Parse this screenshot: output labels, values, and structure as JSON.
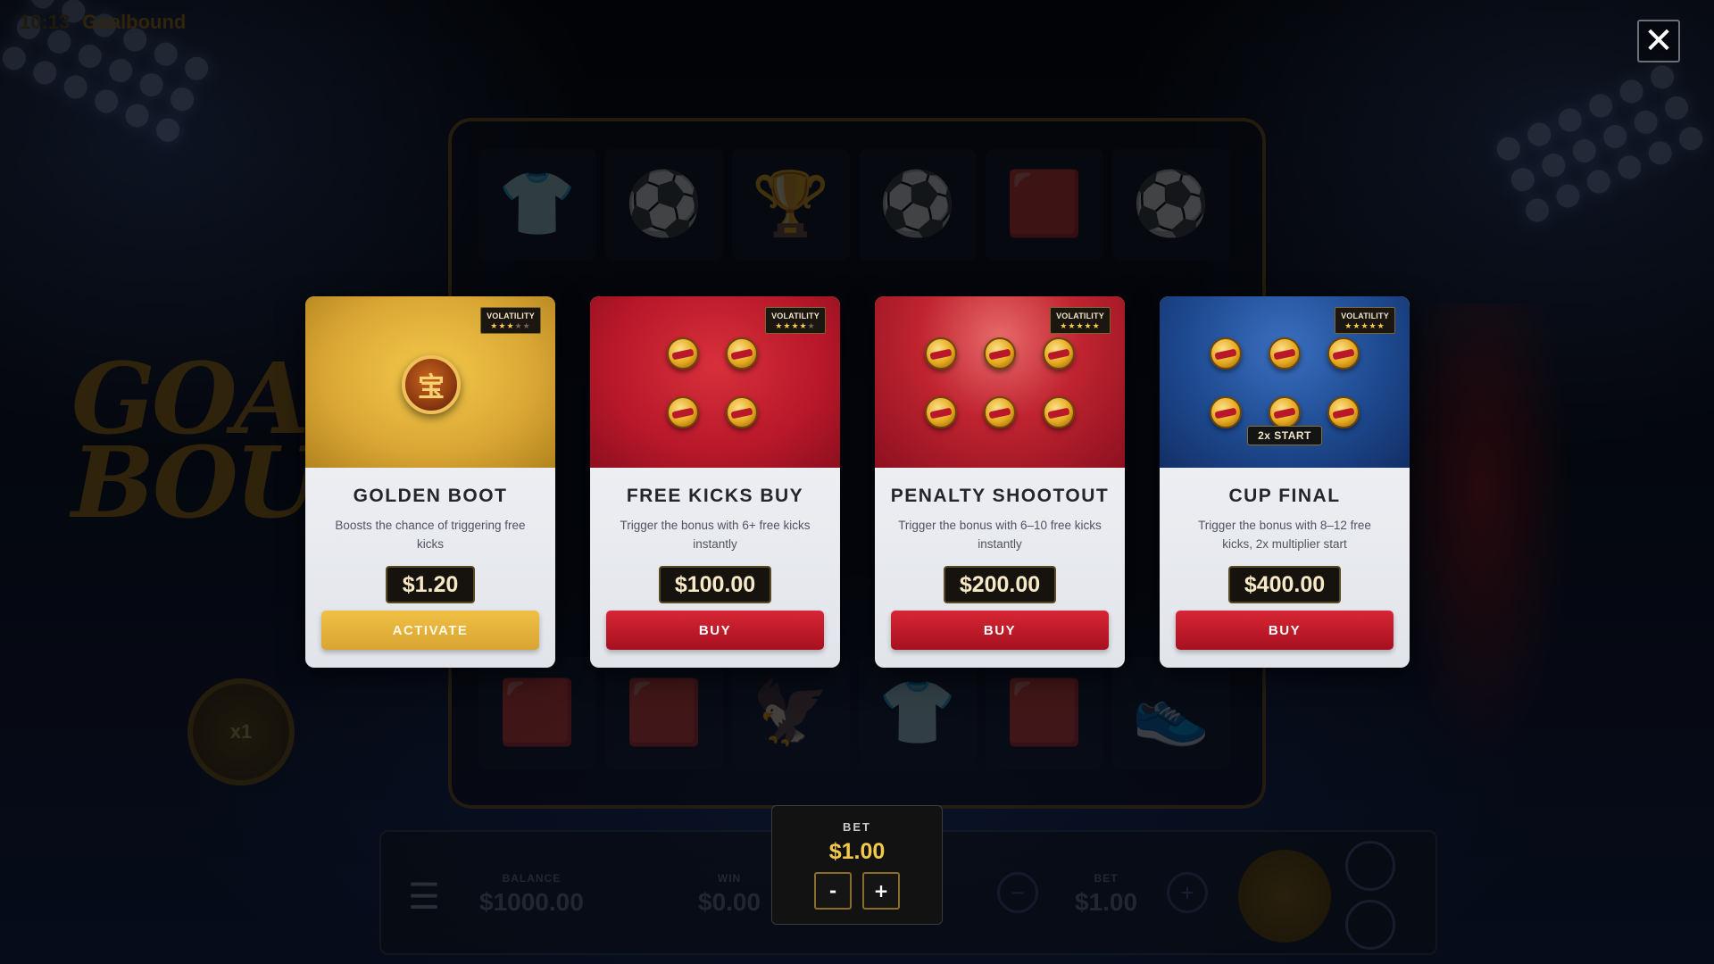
{
  "status_bar": {
    "time": "10:13",
    "game_name": "Goalbound"
  },
  "background": {
    "logo_line1": "GOA",
    "logo_line2": "BOUN",
    "multiplier": "x1",
    "reels_top": [
      "👕",
      "⚽",
      "🏆",
      "⚽",
      "🟥",
      "⚽"
    ],
    "reels_bottom": [
      "🟥",
      "🟥",
      "🦅",
      "👕",
      "🟥",
      "👟"
    ],
    "balance_label": "BALANCE",
    "balance_value": "$1000.00",
    "win_label": "WIN",
    "win_value": "$0.00",
    "bet_label": "BET",
    "bet_value": "$1.00",
    "minus": "−",
    "plus": "+"
  },
  "close_label": "✕",
  "cards": [
    {
      "title": "GOLDEN BOOT",
      "description": "Boosts the chance of triggering free kicks",
      "price": "$1.20",
      "action": "ACTIVATE",
      "volatility_label": "VOLATILITY",
      "volatility_level": 3,
      "volatility_max": 5,
      "art_symbol": "宝",
      "coin_count": 0,
      "badge": ""
    },
    {
      "title": "FREE KICKS BUY",
      "description": "Trigger the bonus with 6+ free kicks instantly",
      "price": "$100.00",
      "action": "BUY",
      "volatility_label": "VOLATILITY",
      "volatility_level": 4,
      "volatility_max": 5,
      "coin_count": 4,
      "badge": ""
    },
    {
      "title": "PENALTY SHOOTOUT",
      "description": "Trigger the bonus with 6–10 free kicks instantly",
      "price": "$200.00",
      "action": "BUY",
      "volatility_label": "VOLATILITY",
      "volatility_level": 5,
      "volatility_max": 5,
      "coin_count": 6,
      "badge": ""
    },
    {
      "title": "CUP FINAL",
      "description": "Trigger the bonus with 8–12 free kicks, 2x multiplier start",
      "price": "$400.00",
      "action": "BUY",
      "volatility_label": "VOLATILITY",
      "volatility_level": 5,
      "volatility_max": 5,
      "coin_count": 6,
      "badge": "2x START"
    }
  ],
  "bet_panel": {
    "label": "BET",
    "value": "$1.00",
    "minus": "-",
    "plus": "+"
  }
}
